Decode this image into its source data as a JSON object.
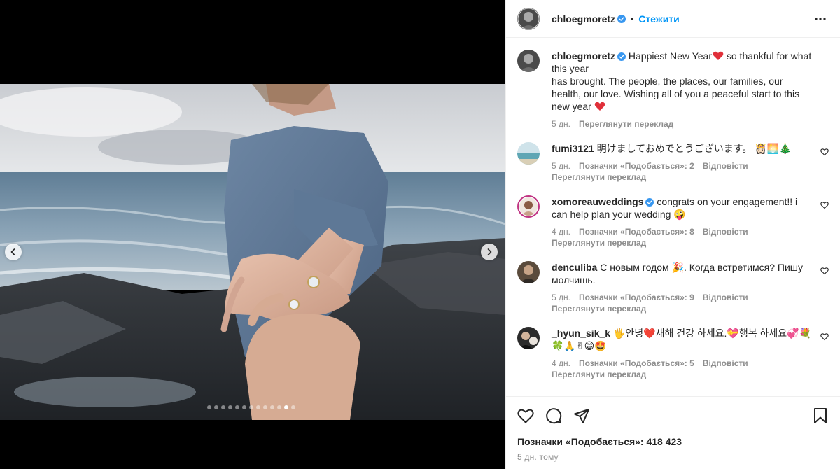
{
  "media": {
    "slide_count": 13,
    "active_slide": 12
  },
  "header": {
    "username": "chloegmoretz",
    "separator": "•",
    "follow_label": "Стежити"
  },
  "caption": {
    "username": "chloegmoretz",
    "text_line1": " Happiest New Year",
    "text_line1b": " so thankful for what this year",
    "text_line2": "has brought. The people, the places, our families, our health, our love. Wishing all of you a peaceful start to this new year ",
    "time": "5 дн.",
    "translate": "Переглянути переклад"
  },
  "comments": [
    {
      "username": "fumi3121",
      "text": " 明けましておめでとうございます。 👸🏻🌅🎄",
      "time": "5 дн.",
      "likes": "Позначки «Подобається»: 2",
      "reply": "Відповісти",
      "translate": "Переглянути переклад"
    },
    {
      "username": "xomoreauweddings",
      "text": " congrats on your engagement!! i can help plan your wedding 🤪",
      "time": "4 дн.",
      "likes": "Позначки «Подобається»: 8",
      "reply": "Відповісти",
      "translate": "Переглянути переклад"
    },
    {
      "username": "denculiba",
      "text": " С новым годом 🎉. Когда встретимся? Пишу молчишь.",
      "time": "5 дн.",
      "likes": "Позначки «Подобається»: 9",
      "reply": "Відповісти",
      "translate": "Переглянути переклад"
    },
    {
      "username": "_hyun_sik_k",
      "text": " 🖐안녕❤️새해 건강 하세요.💝행복 하세요💞💐🍀🙏✌😁🤩",
      "time": "4 дн.",
      "likes": "Позначки «Подобається»: 5",
      "reply": "Відповісти",
      "translate": "Переглянути переклад"
    }
  ],
  "footer": {
    "likes": "Позначки «Подобається»: 418 423",
    "time": "5 дн. тому"
  },
  "colors": {
    "accent": "#0095f6",
    "verified": "#3897f0",
    "heart": "#ed4956",
    "secondary_text": "#8e8e8e"
  }
}
